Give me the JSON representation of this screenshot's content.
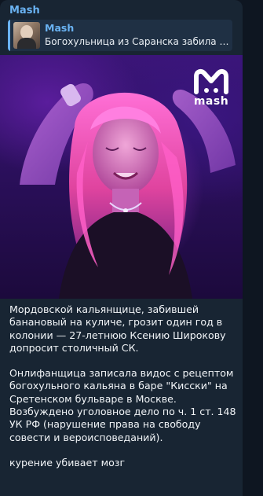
{
  "message": {
    "sender": "Mash",
    "reply": {
      "name": "Mash",
      "text": "Богохульница из Саранска забила к..."
    },
    "photo": {
      "watermark_text": "mash"
    },
    "paragraphs": [
      "Мордовской кальянщице, забившей банановый на куличе, грозит один год в колонии — 27-летнюю Ксению Широкову допросит столичный СК.",
      "Онлифанщица записала видос с рецептом богохульного кальяна в баре \"Кисски\" на Сретенском бульваре в Москве. Возбуждено уголовное дело по ч. 1 ст. 148 УК РФ (нарушение права на свободу совести и вероисповеданий).",
      "курение убивает мозг"
    ]
  },
  "colors": {
    "background": "#0e1621",
    "bubble": "#182533",
    "accent": "#6ab3f3",
    "text": "#f2f5f8"
  }
}
